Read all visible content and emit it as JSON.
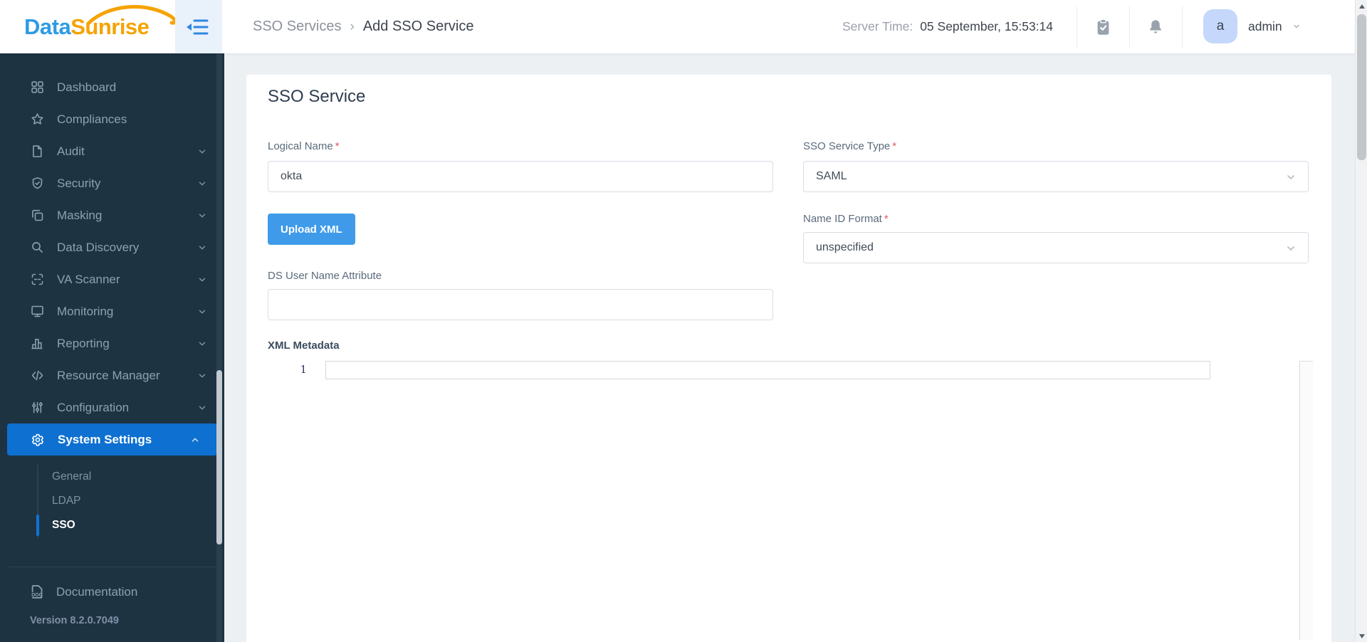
{
  "colors": {
    "accent_blue": "#0e70d1",
    "button_blue": "#3f9be9",
    "sidebar_bg": "#1e3342",
    "logo_blue": "#2f9be4",
    "logo_orange": "#f5a302",
    "required_red": "#e25563"
  },
  "header": {
    "logo": {
      "part1": "Data",
      "part2": "Sunrise"
    },
    "breadcrumb": {
      "items": [
        "SSO Services",
        "Add SSO Service"
      ],
      "separator": "›"
    },
    "server_time": {
      "label": "Server Time:",
      "value": "05 September, 15:53:14"
    },
    "user": {
      "avatar_initial": "a",
      "name": "admin"
    }
  },
  "sidebar": {
    "items": [
      {
        "label": "Dashboard",
        "icon": "dashboard-grid"
      },
      {
        "label": "Compliances",
        "icon": "star"
      },
      {
        "label": "Audit",
        "icon": "file",
        "expandable": true
      },
      {
        "label": "Security",
        "icon": "shield-check",
        "expandable": true
      },
      {
        "label": "Masking",
        "icon": "copy",
        "expandable": true
      },
      {
        "label": "Data Discovery",
        "icon": "search",
        "expandable": true
      },
      {
        "label": "VA Scanner",
        "icon": "scan-frame",
        "expandable": true
      },
      {
        "label": "Monitoring",
        "icon": "monitor",
        "expandable": true
      },
      {
        "label": "Reporting",
        "icon": "bar-chart",
        "expandable": true
      },
      {
        "label": "Resource Manager",
        "icon": "code",
        "expandable": true
      },
      {
        "label": "Configuration",
        "icon": "sliders",
        "expandable": true
      },
      {
        "label": "System Settings",
        "icon": "gear",
        "expandable": true,
        "expanded": true,
        "active": true
      }
    ],
    "submenu": {
      "parent": "System Settings",
      "items": [
        {
          "label": "General"
        },
        {
          "label": "LDAP"
        },
        {
          "label": "SSO",
          "active": true
        }
      ]
    },
    "documentation_label": "Documentation",
    "version": "Version 8.2.0.7049"
  },
  "page": {
    "form": {
      "title": "SSO Service",
      "required_marker": "*",
      "logical_name": {
        "label": "Logical Name",
        "value": "okta",
        "required": true
      },
      "sso_service_type": {
        "label": "SSO Service Type",
        "value": "SAML",
        "required": true
      },
      "upload_xml_button": "Upload XML",
      "name_id_format": {
        "label": "Name ID Format",
        "value": "unspecified",
        "required": true
      },
      "ds_user_name_attribute": {
        "label": "DS User Name Attribute",
        "value": ""
      },
      "xml_metadata": {
        "label": "XML Metadata",
        "first_line_number": "1",
        "content": ""
      }
    }
  }
}
